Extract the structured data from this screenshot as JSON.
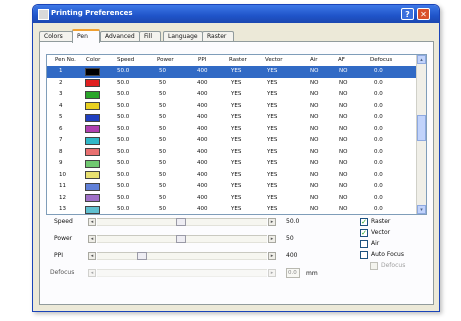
{
  "window": {
    "title": "Printing Preferences",
    "help_label": "?",
    "close_label": "✕"
  },
  "tabs": [
    {
      "label": "Colors"
    },
    {
      "label": "Pen"
    },
    {
      "label": "Advanced"
    },
    {
      "label": "Fill"
    },
    {
      "label": "Language"
    },
    {
      "label": "Raster"
    }
  ],
  "table": {
    "headers": [
      "Pen No.",
      "Color",
      "Speed",
      "Power",
      "PPI",
      "Raster",
      "Vector",
      "Air",
      "AF",
      "Defocus"
    ],
    "rows": [
      {
        "pen": "1",
        "color": "#000000",
        "speed": "50.0",
        "power": "50",
        "ppi": "400",
        "raster": "YES",
        "vector": "YES",
        "air": "NO",
        "af": "NO",
        "defocus": "0.0"
      },
      {
        "pen": "2",
        "color": "#e02020",
        "speed": "50.0",
        "power": "50",
        "ppi": "400",
        "raster": "YES",
        "vector": "YES",
        "air": "NO",
        "af": "NO",
        "defocus": "0.0"
      },
      {
        "pen": "3",
        "color": "#2aa52a",
        "speed": "50.0",
        "power": "50",
        "ppi": "400",
        "raster": "YES",
        "vector": "YES",
        "air": "NO",
        "af": "NO",
        "defocus": "0.0"
      },
      {
        "pen": "4",
        "color": "#e8d020",
        "speed": "50.0",
        "power": "50",
        "ppi": "400",
        "raster": "YES",
        "vector": "YES",
        "air": "NO",
        "af": "NO",
        "defocus": "0.0"
      },
      {
        "pen": "5",
        "color": "#2040c0",
        "speed": "50.0",
        "power": "50",
        "ppi": "400",
        "raster": "YES",
        "vector": "YES",
        "air": "NO",
        "af": "NO",
        "defocus": "0.0"
      },
      {
        "pen": "6",
        "color": "#b040b0",
        "speed": "50.0",
        "power": "50",
        "ppi": "400",
        "raster": "YES",
        "vector": "YES",
        "air": "NO",
        "af": "NO",
        "defocus": "0.0"
      },
      {
        "pen": "7",
        "color": "#30b8c8",
        "speed": "50.0",
        "power": "50",
        "ppi": "400",
        "raster": "YES",
        "vector": "YES",
        "air": "NO",
        "af": "NO",
        "defocus": "0.0"
      },
      {
        "pen": "8",
        "color": "#e87070",
        "speed": "50.0",
        "power": "50",
        "ppi": "400",
        "raster": "YES",
        "vector": "YES",
        "air": "NO",
        "af": "NO",
        "defocus": "0.0"
      },
      {
        "pen": "9",
        "color": "#70c870",
        "speed": "50.0",
        "power": "50",
        "ppi": "400",
        "raster": "YES",
        "vector": "YES",
        "air": "NO",
        "af": "NO",
        "defocus": "0.0"
      },
      {
        "pen": "10",
        "color": "#e8e070",
        "speed": "50.0",
        "power": "50",
        "ppi": "400",
        "raster": "YES",
        "vector": "YES",
        "air": "NO",
        "af": "NO",
        "defocus": "0.0"
      },
      {
        "pen": "11",
        "color": "#6080d8",
        "speed": "50.0",
        "power": "50",
        "ppi": "400",
        "raster": "YES",
        "vector": "YES",
        "air": "NO",
        "af": "NO",
        "defocus": "0.0"
      },
      {
        "pen": "12",
        "color": "#a070c8",
        "speed": "50.0",
        "power": "50",
        "ppi": "400",
        "raster": "YES",
        "vector": "YES",
        "air": "NO",
        "af": "NO",
        "defocus": "0.0"
      },
      {
        "pen": "13",
        "color": "#60c0d0",
        "speed": "50.0",
        "power": "50",
        "ppi": "400",
        "raster": "YES",
        "vector": "YES",
        "air": "NO",
        "af": "NO",
        "defocus": "0.0"
      }
    ]
  },
  "controls": {
    "speed": {
      "label": "Speed",
      "value": "50.0"
    },
    "power": {
      "label": "Power",
      "value": "50"
    },
    "ppi": {
      "label": "PPI",
      "value": "400"
    },
    "defocus": {
      "label": "Defocus",
      "value": "0.0",
      "unit": "mm"
    }
  },
  "options": [
    {
      "label": "Raster",
      "checked": true,
      "enabled": true
    },
    {
      "label": "Vector",
      "checked": true,
      "enabled": true
    },
    {
      "label": "Air",
      "checked": false,
      "enabled": true
    },
    {
      "label": "Auto Focus",
      "checked": false,
      "enabled": true
    },
    {
      "label": "Defocus",
      "checked": false,
      "enabled": false
    }
  ],
  "scroll_arrows": {
    "left": "◂",
    "right": "▸",
    "up": "▴",
    "down": "▾",
    "check": "✓"
  }
}
